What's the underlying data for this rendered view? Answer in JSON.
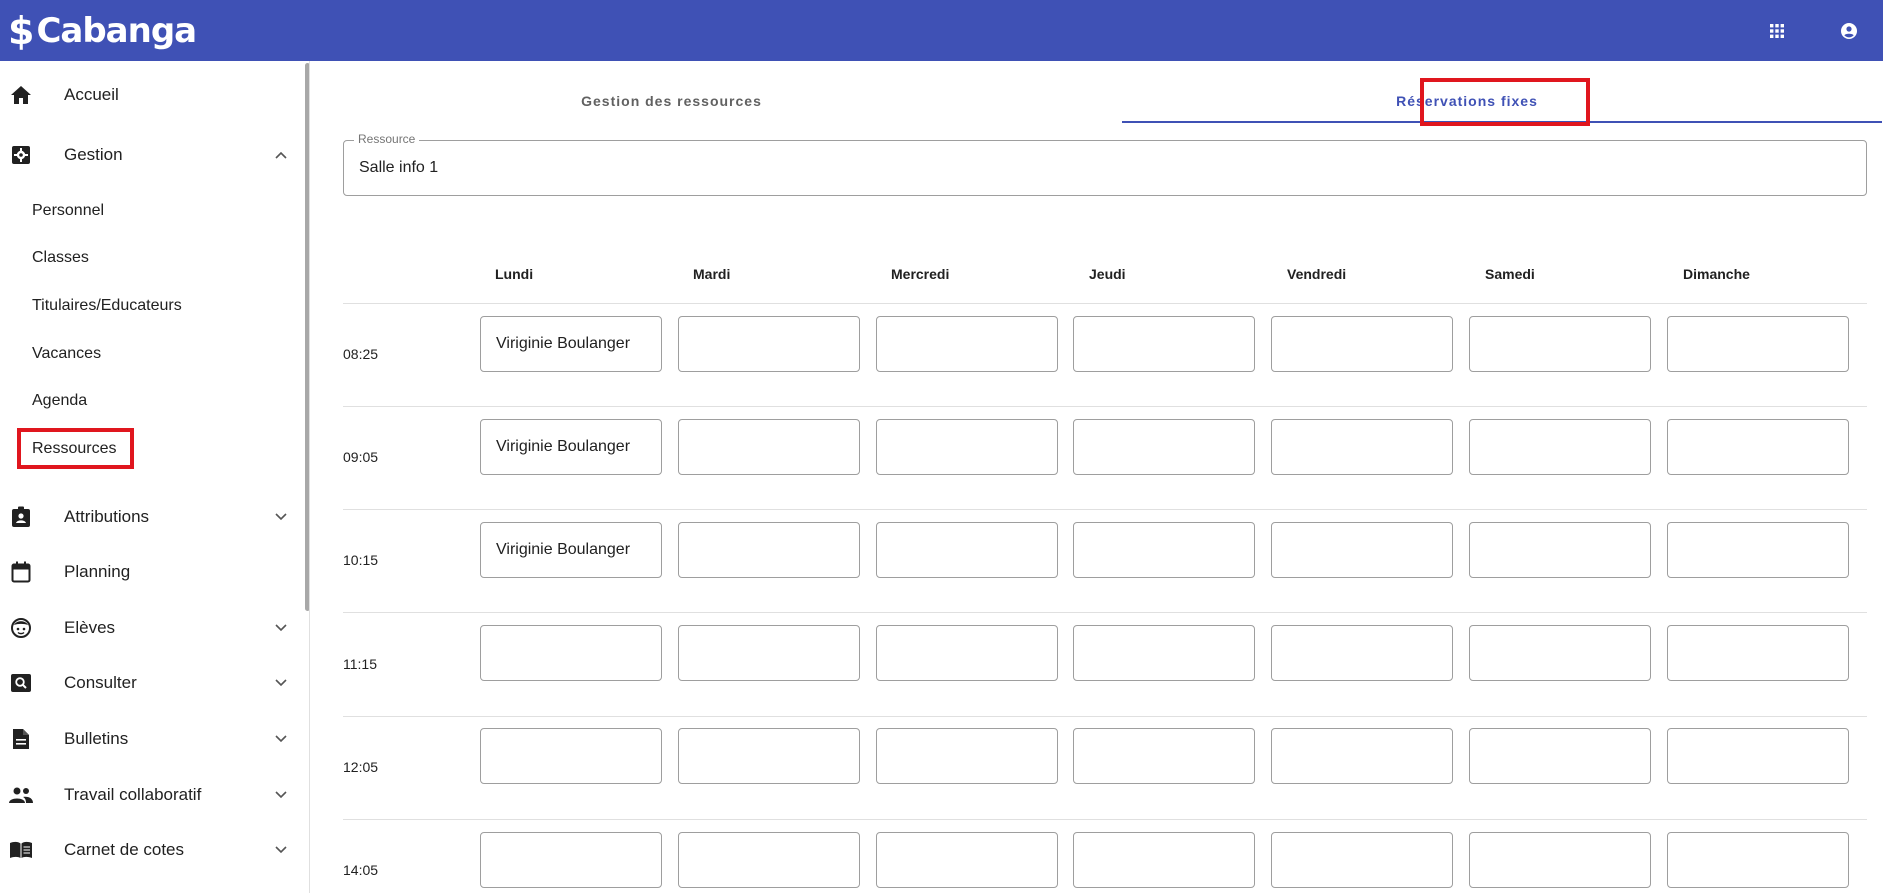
{
  "header": {
    "logo_symbol": "$",
    "logo_text": "Cabanga",
    "background": "#3f51b5"
  },
  "sidebar": {
    "accueil": "Accueil",
    "gestion": "Gestion",
    "gestion_sub": {
      "personnel": "Personnel",
      "classes": "Classes",
      "titulaires": "Titulaires/Educateurs",
      "vacances": "Vacances",
      "agenda": "Agenda",
      "ressources": "Ressources"
    },
    "attributions": "Attributions",
    "planning": "Planning",
    "eleves": "Elèves",
    "consulter": "Consulter",
    "bulletins": "Bulletins",
    "travail": "Travail collaboratif",
    "carnet": "Carnet de cotes"
  },
  "tabs": {
    "gestion": "Gestion des ressources",
    "reservations": "Réservations fixes"
  },
  "resource_field": {
    "label": "Ressource",
    "value": "Salle info 1"
  },
  "schedule": {
    "days": {
      "lundi": "Lundi",
      "mardi": "Mardi",
      "mercredi": "Mercredi",
      "jeudi": "Jeudi",
      "vendredi": "Vendredi",
      "samedi": "Samedi",
      "dimanche": "Dimanche"
    },
    "times": {
      "t1": "08:25",
      "t2": "09:05",
      "t3": "10:15",
      "t4": "11:15",
      "t5": "12:05",
      "t6": "14:05"
    },
    "reservations": {
      "t1_lundi": "Viriginie Boulanger",
      "t2_lundi": "Viriginie Boulanger",
      "t3_lundi": "Viriginie Boulanger"
    }
  },
  "colors": {
    "primary": "#3f51b5",
    "highlight": "#e0161e"
  }
}
